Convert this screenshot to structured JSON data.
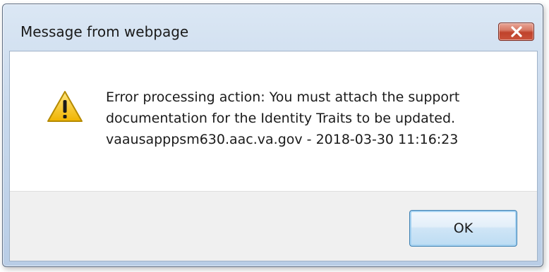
{
  "dialog": {
    "title": "Message from webpage",
    "close_icon": "close-x-icon",
    "warning_icon": "warning-triangle-icon",
    "message_lines": [
      "Error processing action: You must attach the support",
      "documentation for the Identity Traits to be updated.",
      "vaausapppsm630.aac.va.gov - 2018-03-30 11:16:23"
    ],
    "ok_label": "OK"
  },
  "colors": {
    "close_button": "#c9523b",
    "ok_border": "#3c7fb1",
    "warning_yellow": "#f5c518"
  }
}
